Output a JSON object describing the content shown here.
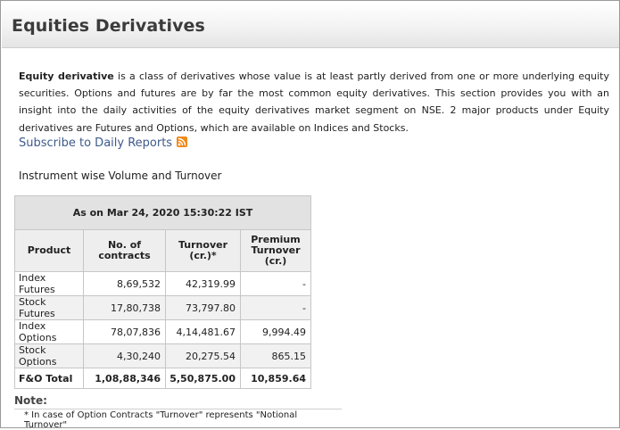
{
  "header": {
    "title": "Equities Derivatives"
  },
  "intro": {
    "bold_term": "Equity derivative",
    "text": " is a class of derivatives whose value is at least partly derived from one or more underlying equity securities. Options and futures are by far the most common equity derivatives. This section provides you with an insight into the daily activities of the equity derivatives market segment on NSE. 2 major products under Equity derivatives are Futures and Options, which are available on Indices and Stocks."
  },
  "subscribe": {
    "label": "Subscribe to Daily Reports",
    "icon": "rss-feed-icon",
    "icon_color": "#f08a1c"
  },
  "section": {
    "title": "Instrument wise Volume and Turnover"
  },
  "table": {
    "as_of": "As on Mar 24, 2020 15:30:22 IST",
    "columns": {
      "product": "Product",
      "contracts": "No. of contracts",
      "turnover": "Turnover (cr.)*",
      "premium_line1": "Premium",
      "premium_line2": "Turnover (cr.)"
    },
    "rows": [
      {
        "product": "Index Futures",
        "contracts": "8,69,532",
        "turnover": "42,319.99",
        "premium": "-"
      },
      {
        "product": "Stock Futures",
        "contracts": "17,80,738",
        "turnover": "73,797.80",
        "premium": "-"
      },
      {
        "product": "Index Options",
        "contracts": "78,07,836",
        "turnover": "4,14,481.67",
        "premium": "9,994.49"
      },
      {
        "product": "Stock Options",
        "contracts": "4,30,240",
        "turnover": "20,275.54",
        "premium": "865.15"
      },
      {
        "product": "F&O Total",
        "contracts": "1,08,88,346",
        "turnover": "5,50,875.00",
        "premium": "10,859.64"
      }
    ]
  },
  "note": {
    "title": "Note:",
    "text": "* In case of Option Contracts \"Turnover\" represents \"Notional Turnover\""
  },
  "colors": {
    "link": "#3d5a8a",
    "header_text": "#3b3b3b",
    "table_header_bg": "#e2e2e2"
  }
}
